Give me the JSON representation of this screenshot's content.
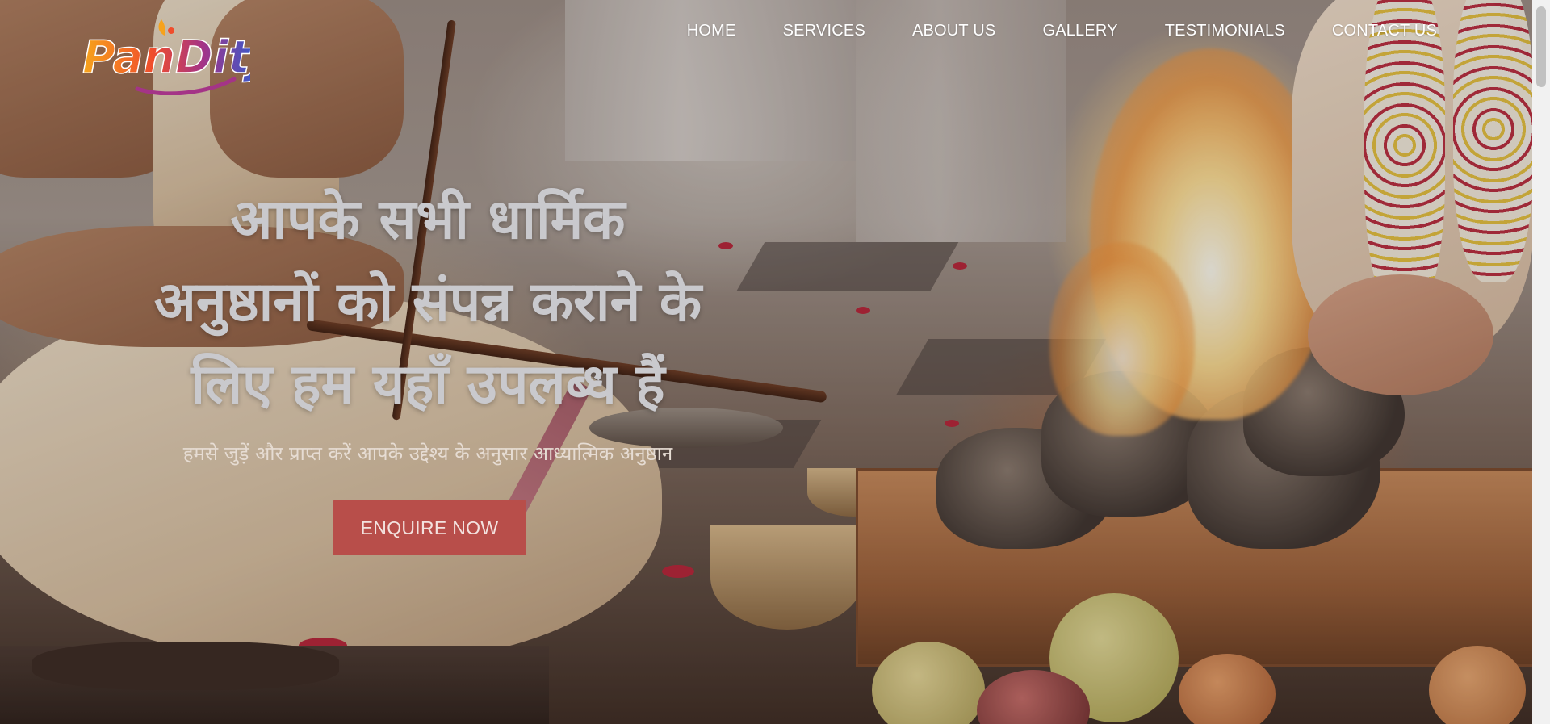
{
  "brand": {
    "logo_text": "PanDitJi"
  },
  "nav": {
    "items": [
      {
        "label": "HOME"
      },
      {
        "label": "SERVICES"
      },
      {
        "label": "ABOUT US"
      },
      {
        "label": "GALLERY"
      },
      {
        "label": "TESTIMONIALS"
      },
      {
        "label": "CONTACT US"
      }
    ]
  },
  "hero": {
    "headline_line1": "आपके सभी धार्मिक",
    "headline_line2": "अनुष्ठानों को संपन्न कराने के",
    "headline_line3": "लिए हम यहाँ उपलब्ध हैं",
    "subheadline": "हमसे जुड़ें और प्राप्त करें आपके उद्देश्य के अनुसार आध्यात्मिक अनुष्ठान",
    "cta_label": "ENQUIRE NOW"
  },
  "colors": {
    "cta": "#b84e4a",
    "nav_text": "#ffffff",
    "headline_text": "#c9c9cd"
  }
}
